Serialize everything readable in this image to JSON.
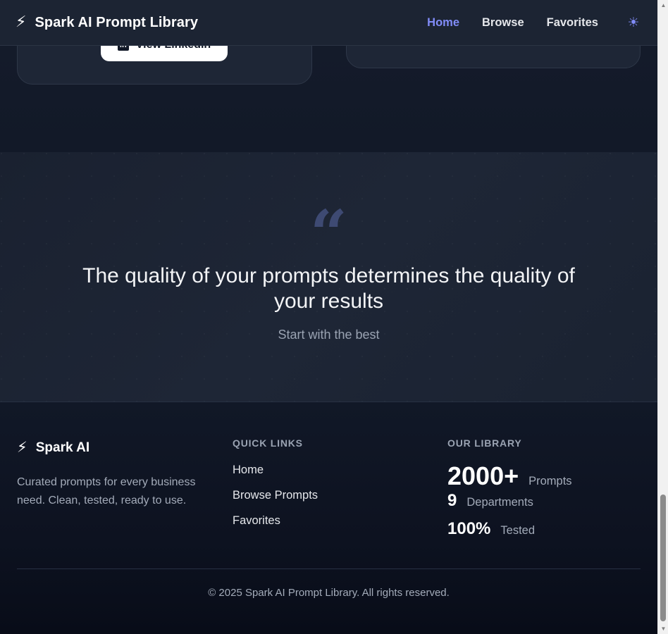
{
  "header": {
    "brand_icon": "bolt-icon",
    "brand_name": "Spark AI Prompt Library",
    "nav": [
      {
        "label": "Home",
        "active": true
      },
      {
        "label": "Browse",
        "active": false
      },
      {
        "label": "Favorites",
        "active": false
      }
    ],
    "theme_icon": "sun-icon"
  },
  "cards": {
    "linkedin_label": "View LinkedIn",
    "linkedin_icon": "linkedin-icon"
  },
  "quote": {
    "mark": "“",
    "text": "The quality of your prompts determines the quality of your results",
    "subtitle": "Start with the best"
  },
  "footer": {
    "brand_name": "Spark AI",
    "description": "Curated prompts for every business need. Clean, tested, ready to use.",
    "quick_links_title": "QUICK LINKS",
    "quick_links": [
      "Home",
      "Browse Prompts",
      "Favorites"
    ],
    "library_title": "OUR LIBRARY",
    "stats": [
      {
        "value": "2000+",
        "label": "Prompts"
      },
      {
        "value": "9",
        "label": "Departments"
      },
      {
        "value": "100%",
        "label": "Tested"
      }
    ],
    "copyright": "© 2025 Spark AI Prompt Library. All rights reserved."
  },
  "colors": {
    "accent": "#818cf8",
    "background": "#0f1523",
    "card": "#1e2636"
  }
}
